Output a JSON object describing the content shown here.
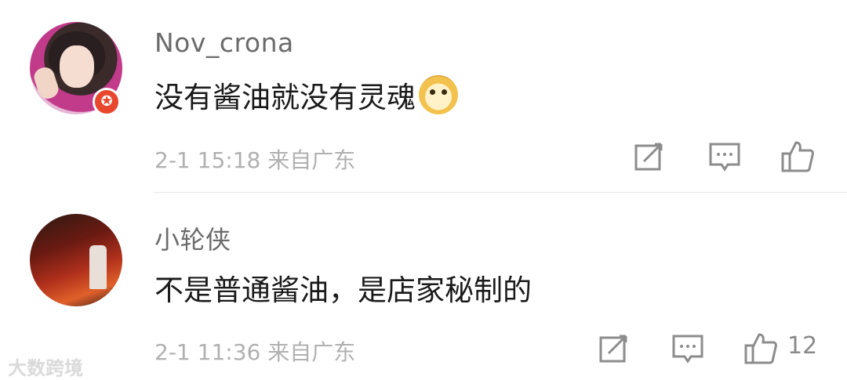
{
  "comments": [
    {
      "username": "Nov_crona",
      "text": "没有酱油就没有灵魂",
      "emoji": "doge-emoji",
      "time": "2-1 15:18",
      "location": "来自广东",
      "avatar_badge": "✪",
      "like_count": ""
    },
    {
      "username": "小轮侠",
      "text": "不是普通酱油，是店家秘制的",
      "time": "2-1 11:36",
      "location": "来自广东",
      "like_count": "12"
    }
  ],
  "icons": {
    "share": "share-icon",
    "comment": "comment-icon",
    "like": "thumbs-up-icon",
    "badge": "star-badge-icon"
  },
  "watermark": "大数跨境",
  "colors": {
    "username": "#6b6b6b",
    "text": "#1a1a1a",
    "meta": "#b0b0b0",
    "badge": "#e8472e"
  }
}
